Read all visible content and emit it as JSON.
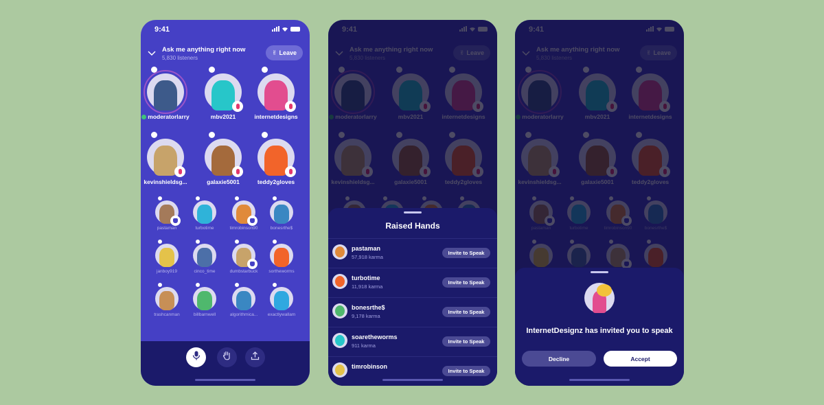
{
  "status_bar": {
    "time": "9:41"
  },
  "room": {
    "title": "Ask me anything right now",
    "listeners": "5,830 listeners",
    "leave_label": "Leave"
  },
  "speakers": [
    {
      "name": "moderatorlarry",
      "role": "moderator",
      "color": "#3d5a8a"
    },
    {
      "name": "mbv2021",
      "role": "muted",
      "color": "#27c6c9"
    },
    {
      "name": "internetdesigns",
      "role": "muted",
      "color": "#e24d8f"
    },
    {
      "name": "kevinshieldsg...",
      "role": "muted",
      "color": "#c7a36a"
    },
    {
      "name": "galaxie5001",
      "role": "muted",
      "color": "#a46a3c"
    },
    {
      "name": "teddy2gloves",
      "role": "muted",
      "color": "#f2642a"
    }
  ],
  "listeners_grid": [
    {
      "name": "pastaman",
      "hand": true,
      "color": "#a47a5a"
    },
    {
      "name": "turbotime",
      "hand": false,
      "color": "#2fb3d9"
    },
    {
      "name": "timrobinson90",
      "hand": true,
      "color": "#e08a3a"
    },
    {
      "name": "bonesrthe$",
      "hand": false,
      "color": "#3a87c2"
    },
    {
      "name": "janboy919",
      "hand": false,
      "color": "#e4c24a"
    },
    {
      "name": "cinco_time",
      "hand": false,
      "color": "#4c6fa8"
    },
    {
      "name": "dumbstarbuck",
      "hand": true,
      "color": "#c7a36a"
    },
    {
      "name": "sortheworms",
      "hand": false,
      "color": "#f2642a"
    },
    {
      "name": "trashcanman",
      "hand": false,
      "color": "#c78f56"
    },
    {
      "name": "billbarnwell",
      "hand": false,
      "color": "#4fb86d"
    },
    {
      "name": "algorithmica...",
      "hand": false,
      "color": "#3a87c2"
    },
    {
      "name": "exactlywallam",
      "hand": false,
      "color": "#2fa8e0"
    }
  ],
  "bottom_bar": {
    "buttons": [
      {
        "icon": "microphone-icon",
        "active": true
      },
      {
        "icon": "raise-hand-icon",
        "active": false
      },
      {
        "icon": "share-icon",
        "active": false
      }
    ]
  },
  "raised_hands": {
    "title": "Raised Hands",
    "invite_label": "Invite to Speak",
    "items": [
      {
        "name": "pastaman",
        "karma": "57,918 karma",
        "color": "#e08a3a"
      },
      {
        "name": "turbotime",
        "karma": "11,918 karma",
        "color": "#f2642a"
      },
      {
        "name": "bonesrthe$",
        "karma": "9,178 karma",
        "color": "#4fb86d"
      },
      {
        "name": "soaretheworms",
        "karma": "911 karma",
        "color": "#27c6c9"
      },
      {
        "name": "timrobinson",
        "karma": "",
        "color": "#e4c24a"
      }
    ]
  },
  "invite": {
    "message": "InternetDesignz has invited you to speak",
    "decline_label": "Decline",
    "accept_label": "Accept"
  }
}
